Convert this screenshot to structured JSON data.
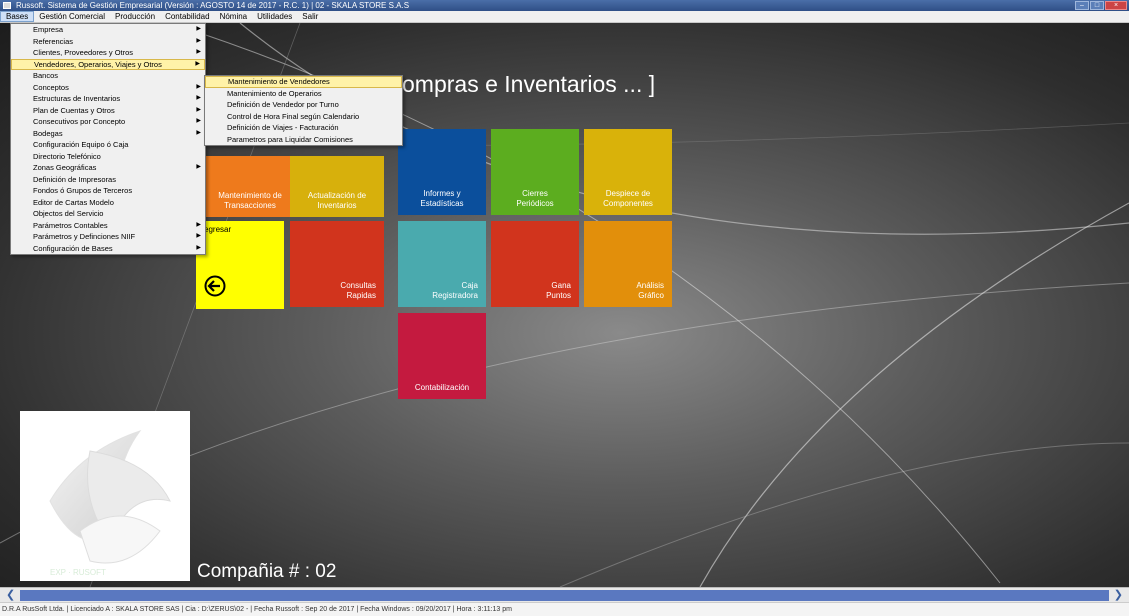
{
  "titlebar": {
    "title": "Russoft. Sistema de Gestión Empresarial (Versión : AGOSTO 14 de 2017 - R.C. 1) | 02 - SKALA STORE S.A.S"
  },
  "menubar": [
    {
      "label": "Bases",
      "active": true
    },
    {
      "label": "Gestión Comercial"
    },
    {
      "label": "Producción"
    },
    {
      "label": "Contabilidad"
    },
    {
      "label": "Nómina"
    },
    {
      "label": "Utilidades"
    },
    {
      "label": "Salir"
    }
  ],
  "bases_menu": [
    {
      "label": "Empresa",
      "submenu": true
    },
    {
      "label": "Referencias",
      "submenu": true
    },
    {
      "label": "Clientes, Proveedores y Otros",
      "submenu": true
    },
    {
      "label": "Vendedores, Operarios, Viajes y Otros",
      "submenu": true,
      "highlighted": true
    },
    {
      "label": "Bancos",
      "submenu": false
    },
    {
      "label": "Conceptos",
      "submenu": true
    },
    {
      "label": "Estructuras de Inventarios",
      "submenu": true
    },
    {
      "label": "Plan de Cuentas y Otros",
      "submenu": true
    },
    {
      "label": "Consecutivos por Concepto",
      "submenu": true
    },
    {
      "label": "Bodegas",
      "submenu": true
    },
    {
      "label": "Configuración  Equipo ó Caja",
      "submenu": false
    },
    {
      "label": "Directorio Telefónico",
      "submenu": false
    },
    {
      "label": "Zonas Geográficas",
      "submenu": true
    },
    {
      "label": "Definición de Impresoras",
      "submenu": false
    },
    {
      "label": "Fondos ó Grupos de Terceros",
      "submenu": false
    },
    {
      "label": "Editor de Cartas Modelo",
      "submenu": false
    },
    {
      "label": "Objectos del Servicio",
      "submenu": false
    },
    {
      "label": "Parámetros Contables",
      "submenu": true
    },
    {
      "label": "Parámetros y Definciones NIIF",
      "submenu": true
    },
    {
      "label": "Configuración de Bases",
      "submenu": true
    }
  ],
  "vendedores_submenu": [
    {
      "label": "Mantenimiento de Vendedores",
      "highlighted": true
    },
    {
      "label": "Mantenimiento de Operarios"
    },
    {
      "label": "Definición de Vendedor por Turno"
    },
    {
      "label": "Control de Hora Final según Calendario"
    },
    {
      "label": "Definición de Viajes - Facturación"
    },
    {
      "label": "Parametros para Liquidar Comisiones"
    }
  ],
  "heading": "ompras e Inventarios ... ]",
  "tiles": [
    {
      "label": "Mantenimiento de\nTransacciones",
      "color": "#ee7a1c"
    },
    {
      "label": "Actualización de\nInventarios",
      "color": "#d7b00c"
    },
    {
      "label": "Informes y\nEstadísticas",
      "color": "#0b4f9c"
    },
    {
      "label": "Cierres\nPeriódicos",
      "color": "#5cad1f"
    },
    {
      "label": "Despiece de\nComponentes",
      "color": "#d9b20a"
    },
    {
      "label": "Consultas\nRapidas",
      "color": "#d1341d"
    },
    {
      "label": "Caja\nRegistradora",
      "color": "#4aaaae"
    },
    {
      "label": "Gana\nPuntos",
      "color": "#d1341d"
    },
    {
      "label": "Análisis\nGráfico",
      "color": "#e28f0b"
    },
    {
      "label": "Contabilización",
      "color": "#c41a3f"
    }
  ],
  "back_tile": {
    "label": "egresar",
    "color": "#ffff00"
  },
  "company_label": "Compañia # : 02",
  "logo_caption": "EXP · RUSOFT",
  "statusbar": "D.R.A RusSoft Ltda. | Licenciado A : SKALA STORE SAS  | Cia : D:\\ZERUS\\02 -  | Fecha Russoft : Sep 20 de 2017 | Fecha Windows : 09/20/2017  | Hora :  3:11:13 pm"
}
